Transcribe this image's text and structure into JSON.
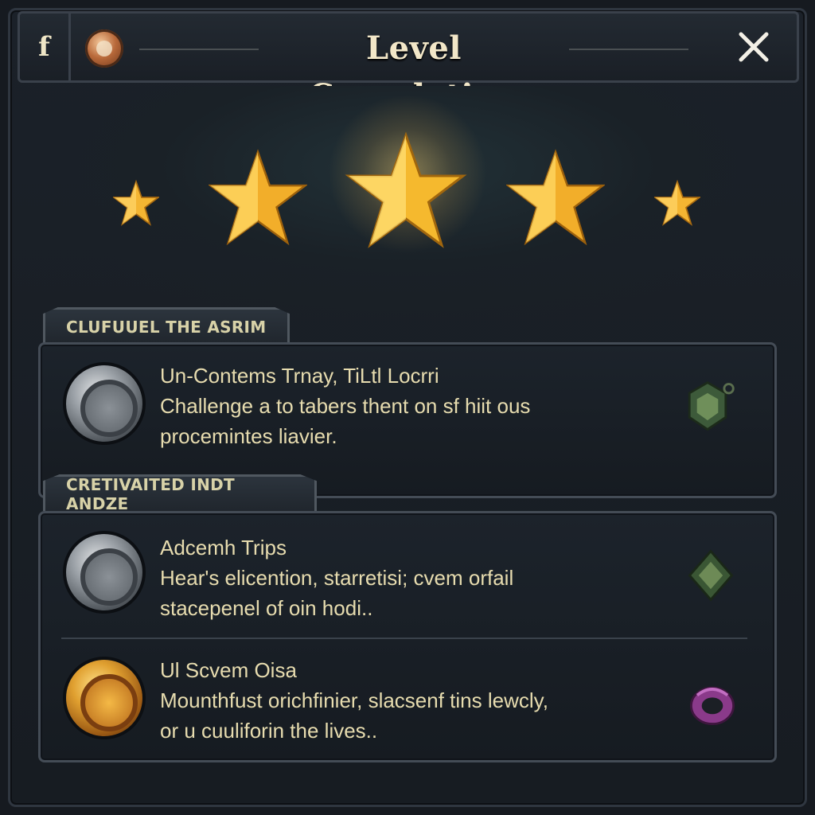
{
  "header": {
    "facebook_label": "f",
    "title": "Level Completion"
  },
  "stars": {
    "count": 5,
    "icons": [
      "small-star-icon",
      "star-icon",
      "center-star-icon",
      "star-icon",
      "small-star-icon"
    ]
  },
  "sections": [
    {
      "tab_label": "CLUFUUEL THE ASRIM",
      "items": [
        {
          "medal": "silver",
          "title": "Un-Contems Trnay, TiLtl Locrri",
          "line1": "Challenge a to tabers thent on sf hiit ous",
          "line2": "procemintes liavier.",
          "reward_icon": "green-amulet-icon"
        }
      ]
    },
    {
      "tab_label": "CRETIVAITED INDT ANDZE",
      "items": [
        {
          "medal": "silver",
          "title": "Adcemh Trips",
          "line1": "Hear's elicention, starretisi; cvem orfail",
          "line2": "stacepenel of oin hodi..",
          "reward_icon": "green-gem-icon"
        },
        {
          "medal": "gold",
          "title": "Ul Scvem Oisa",
          "line1": "Mounthfust orichfinier, slacsenf tins lewcly,",
          "line2": "or u cuuliforin the lives..",
          "reward_icon": "purple-ring-icon"
        }
      ]
    }
  ],
  "colors": {
    "accent_gold": "#f5c542",
    "text": "#e7dcaf",
    "panel_border": "#444c56"
  }
}
